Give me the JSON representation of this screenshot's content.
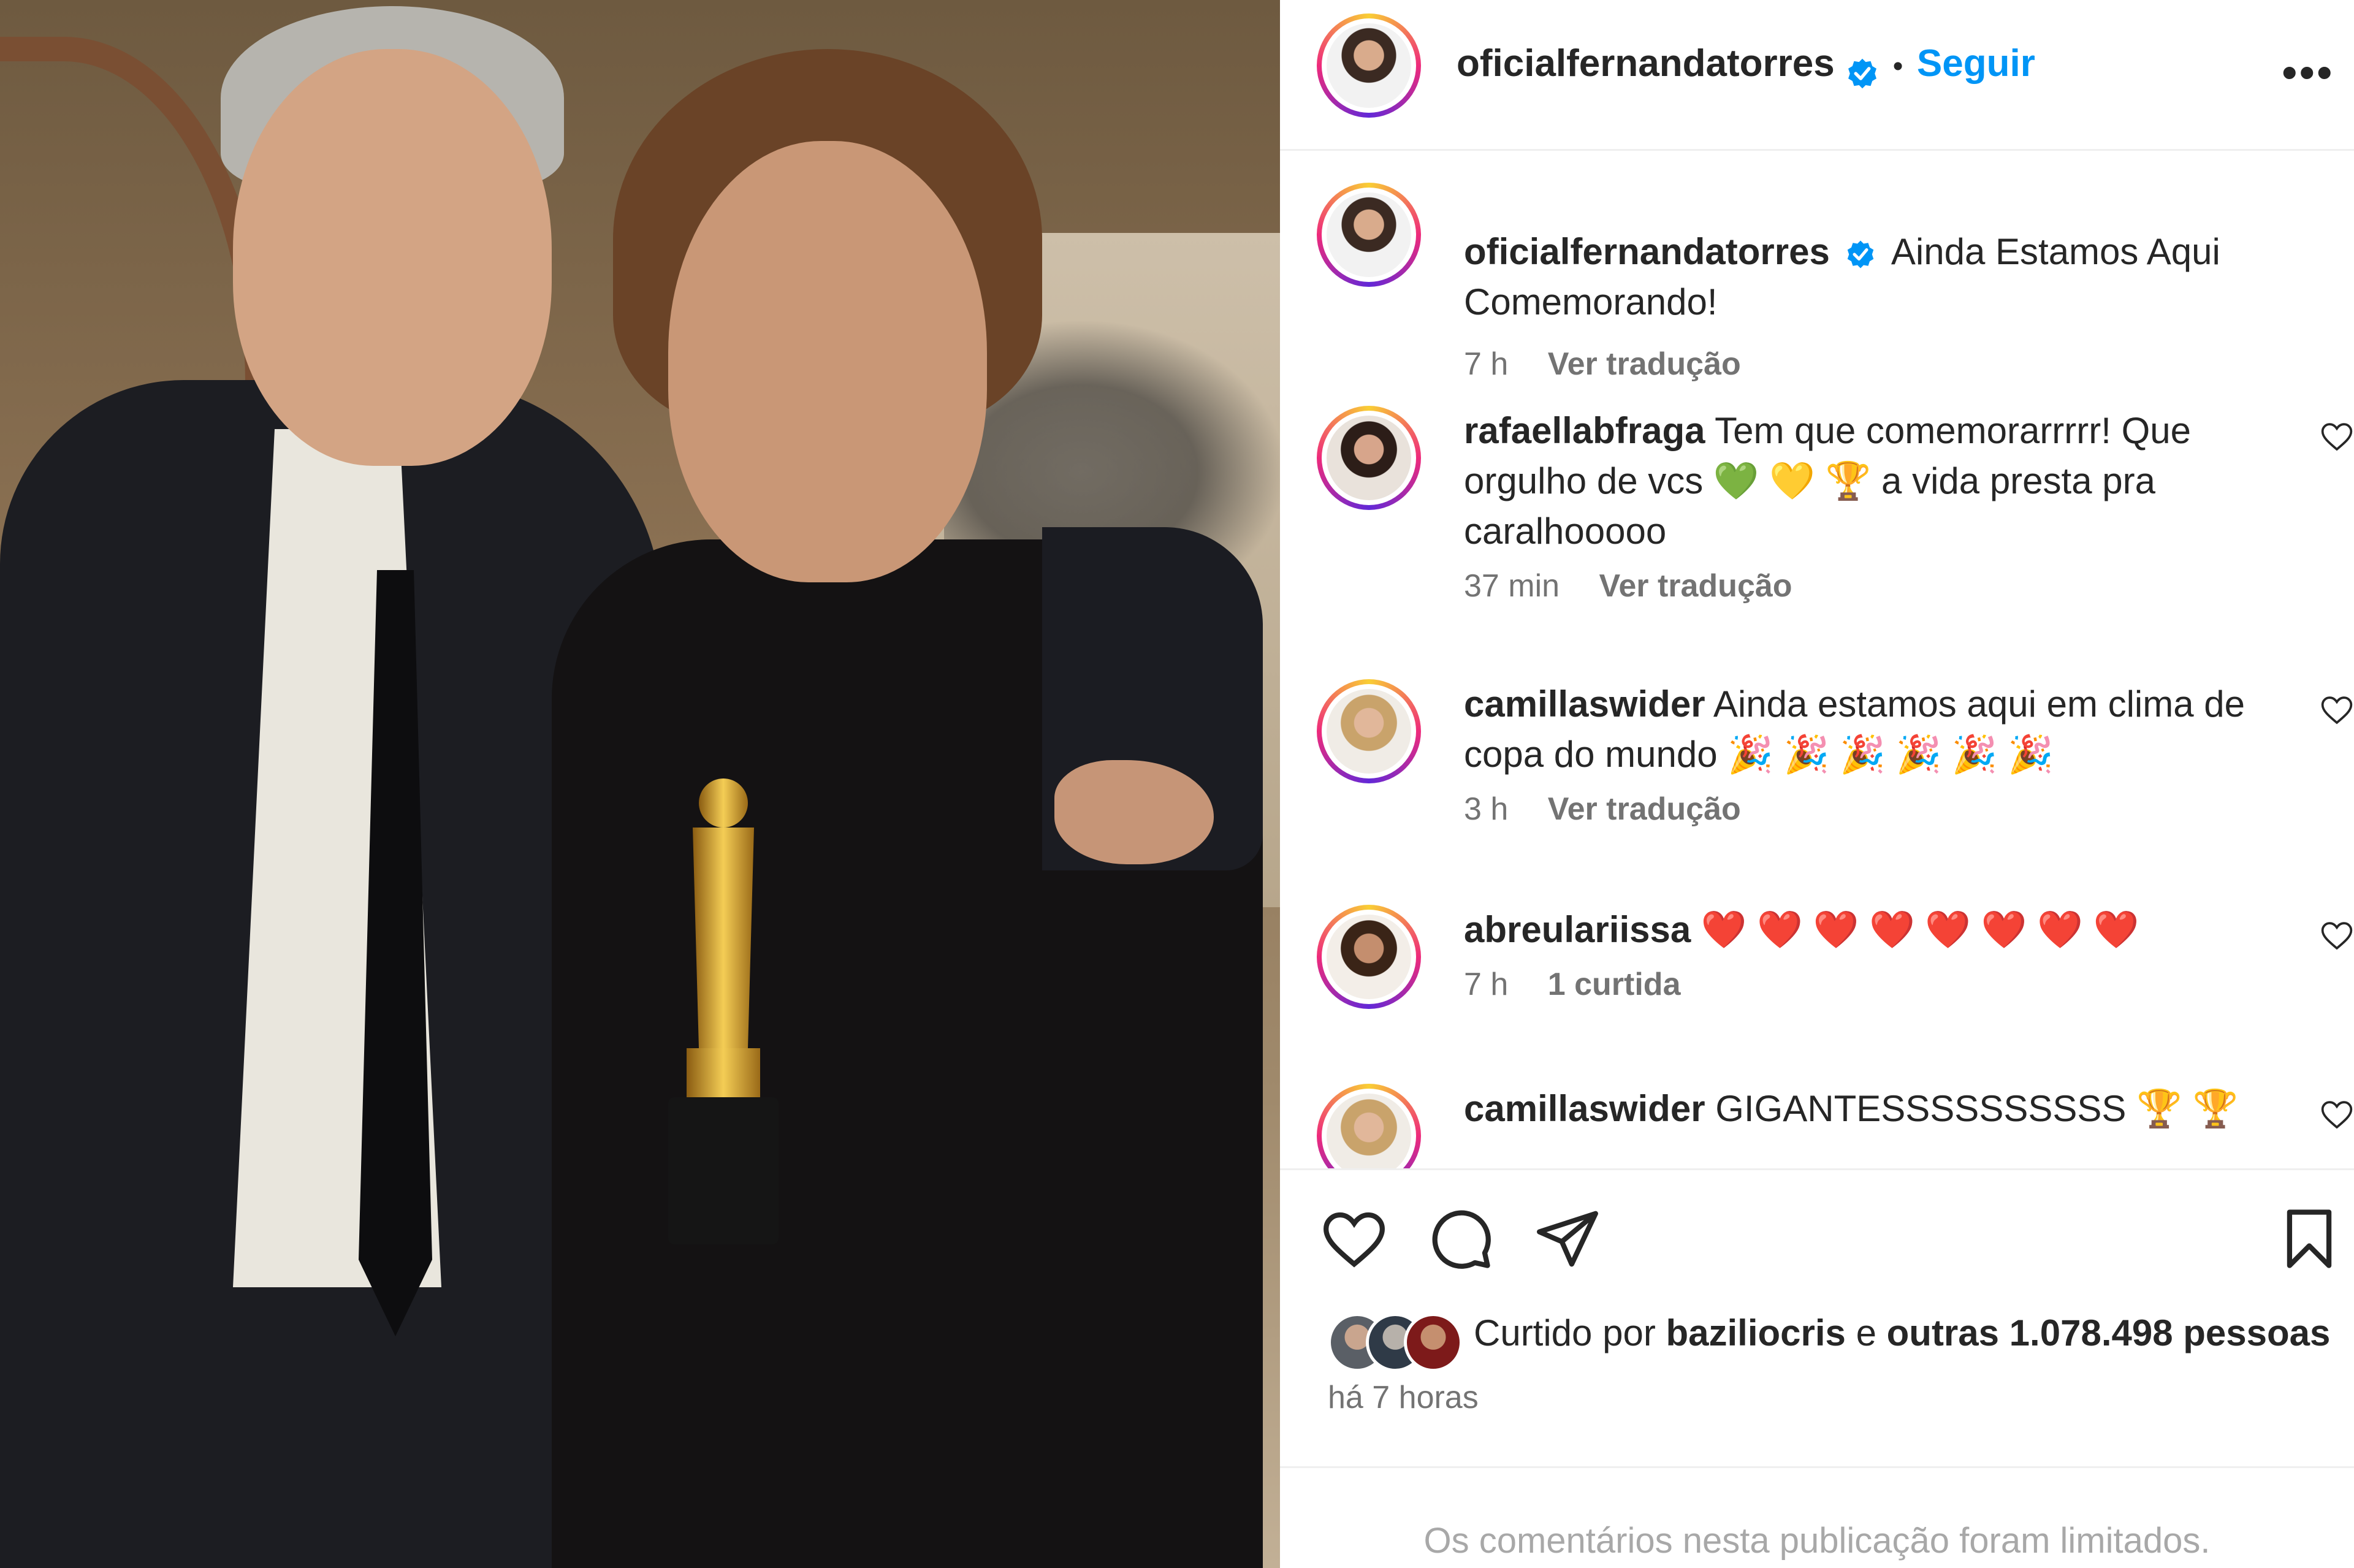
{
  "post": {
    "author": "oficialfernandatorres",
    "follow_label": "Seguir",
    "separator": "•",
    "more_label": "•••"
  },
  "caption": {
    "username": "oficialfernandatorres",
    "text_line1": "Ainda Estamos Aqui",
    "text_line2": "Comemorando!",
    "time": "7 h",
    "translate": "Ver tradução"
  },
  "comments": [
    {
      "username": "rafaellabfraga",
      "line1": "Tem que comemorarrrrr! Que",
      "line2": "orgulho de vcs 💚 💛 🏆 a vida presta pra",
      "line3": "caralhooooo",
      "time": "37 min",
      "action": "Ver tradução"
    },
    {
      "username": "camillaswider",
      "line1": "Ainda estamos aqui em clima de",
      "line2": "copa do mundo 🎉 🎉 🎉 🎉 🎉 🎉",
      "time": "3 h",
      "action": "Ver tradução"
    },
    {
      "username": "abreulariissa",
      "line1": "❤️ ❤️ ❤️ ❤️ ❤️ ❤️ ❤️ ❤️",
      "time": "7 h",
      "action": "1 curtida"
    },
    {
      "username": "camillaswider",
      "line1": "GIGANTESSSSSSSSSS 🏆 🏆"
    }
  ],
  "likes": {
    "prefix": "Curtido por",
    "user": "baziliocris",
    "conj": "e",
    "others": "outras 1.078.498 pessoas"
  },
  "posted_ago": "há 7 horas",
  "comments_limited": "Os comentários nesta publicação foram limitados.",
  "icons": {
    "like": "heart-icon",
    "comment": "comment-bubble-icon",
    "share": "paper-plane-icon",
    "save": "bookmark-icon",
    "verified": "verified-badge-icon",
    "more": "more-options-icon"
  },
  "colors": {
    "follow_blue": "#0095f6",
    "verified_blue": "#0095f6",
    "muted": "#737373",
    "limited_gray": "#a8a8a8"
  }
}
